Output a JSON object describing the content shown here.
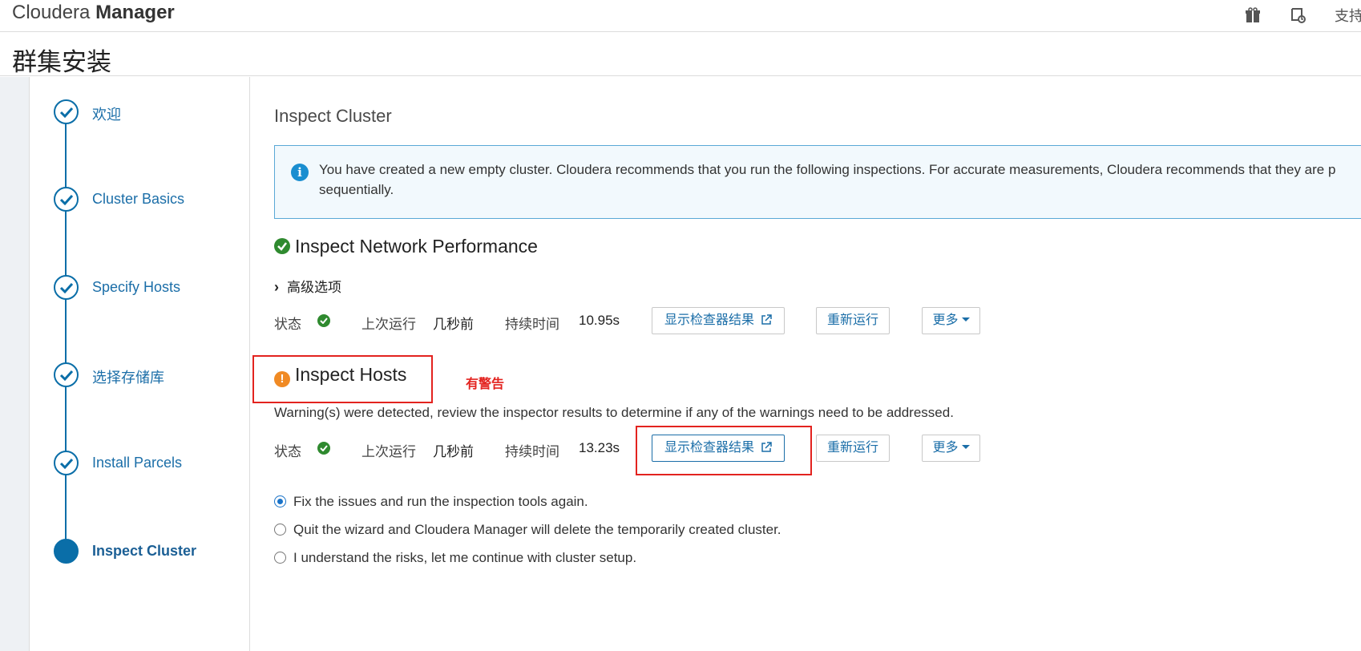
{
  "topbar": {
    "brand_light": "Cloudera",
    "brand_bold": "Manager",
    "support_label": "支持"
  },
  "page": {
    "title": "群集安装"
  },
  "steps": [
    {
      "label": "欢迎",
      "state": "done"
    },
    {
      "label": "Cluster Basics",
      "state": "done"
    },
    {
      "label": "Specify Hosts",
      "state": "done"
    },
    {
      "label": "选择存储库",
      "state": "done"
    },
    {
      "label": "Install Parcels",
      "state": "done"
    },
    {
      "label": "Inspect Cluster",
      "state": "active"
    }
  ],
  "main": {
    "title": "Inspect Cluster",
    "info_text": "You have created a new empty cluster. Cloudera recommends that you run the following inspections. For accurate measurements, Cloudera recommends that they are p sequentially.",
    "network": {
      "title": "Inspect Network Performance",
      "advanced_label": "高级选项",
      "status_label": "状态",
      "last_run_label": "上次运行",
      "last_run_value": "几秒前",
      "duration_label": "持续时间",
      "duration_value": "10.95s",
      "show_results_label": "显示检查器结果",
      "rerun_label": "重新运行",
      "more_label": "更多"
    },
    "hosts": {
      "title": "Inspect Hosts",
      "warning_text": "Warning(s) were detected, review the inspector results to determine if any of the warnings need to be addressed.",
      "status_label": "状态",
      "last_run_label": "上次运行",
      "last_run_value": "几秒前",
      "duration_label": "持续时间",
      "duration_value": "13.23s",
      "show_results_label": "显示检查器结果",
      "rerun_label": "重新运行",
      "more_label": "更多"
    },
    "options": [
      {
        "label": "Fix the issues and run the inspection tools again.",
        "checked": true
      },
      {
        "label": "Quit the wizard and Cloudera Manager will delete the temporarily created cluster.",
        "checked": false
      },
      {
        "label": "I understand the risks, let me continue with cluster setup.",
        "checked": false
      }
    ]
  },
  "annotation": {
    "note": "有警告",
    "color": "#e3231f"
  },
  "colors": {
    "accent": "#1b6ea8",
    "success": "#2f8a2f",
    "warning": "#f08a24"
  }
}
